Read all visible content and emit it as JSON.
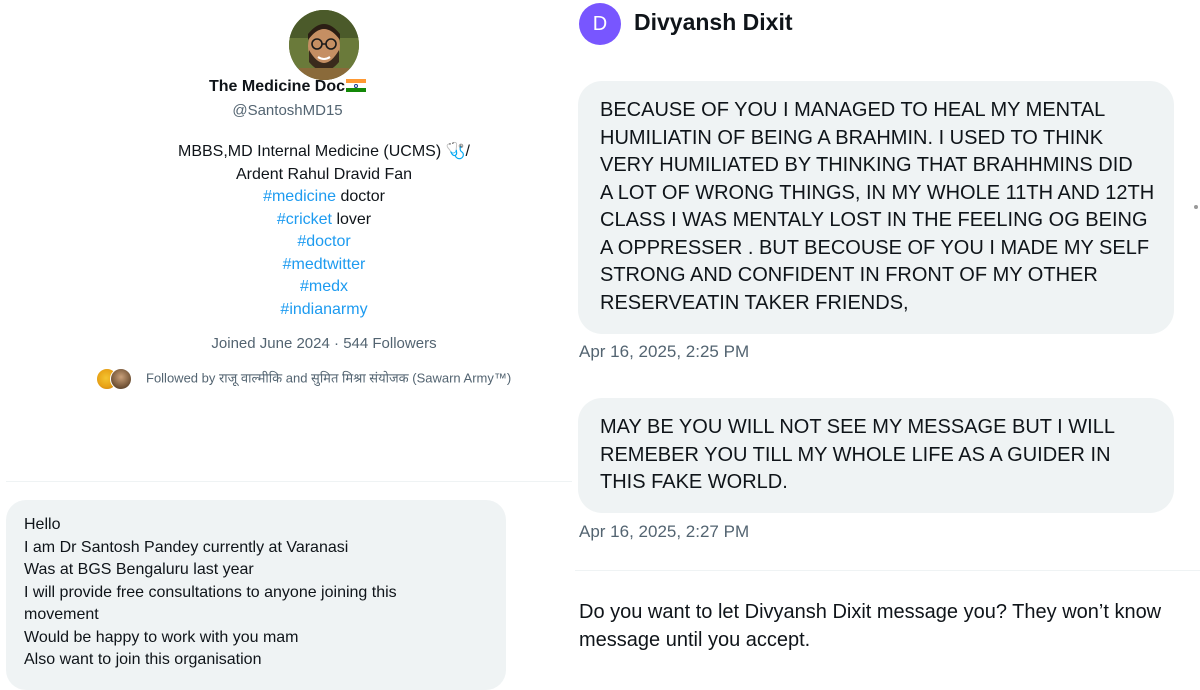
{
  "profile": {
    "name": "The Medicine Doc",
    "handle": "@SantoshMD15",
    "bio_lines": [
      {
        "text": "MBBS,MD Internal Medicine (UCMS) 🩺/",
        "tag": ""
      },
      {
        "text": "Ardent Rahul Dravid Fan",
        "tag": ""
      },
      {
        "tag": "#medicine",
        "text": " doctor"
      },
      {
        "tag": "#cricket",
        "text": " lover"
      },
      {
        "tag": "#doctor",
        "text": ""
      },
      {
        "tag": "#medtwitter",
        "text": ""
      },
      {
        "tag": "#medx",
        "text": ""
      },
      {
        "tag": "#indianarmy",
        "text": ""
      }
    ],
    "joined": "Joined June 2024",
    "followers": "544 Followers",
    "meta_separator": " · ",
    "followed_by": "Followed by राजू वाल्मीकि and सुमित मिश्रा संयोजक (Sawarn Army™)",
    "hashtag_color": "#1d9bf0"
  },
  "left_message": {
    "lines": [
      "Hello",
      "I am Dr Santosh Pandey currently at Varanasi",
      "Was at BGS Bengaluru last year",
      "I will provide free consultations to anyone joining this",
      "movement",
      "Would be happy to work with you mam",
      "Also want to join this organisation"
    ]
  },
  "dm": {
    "avatar_letter": "D",
    "avatar_color": "#7856ff",
    "name": "Divyansh Dixit",
    "messages": [
      {
        "lines": [
          "BECAUSE OF YOU I MANAGED TO HEAL MY MENTAL",
          "HUMILIATIN OF BEING A BRAHMIN. I USED TO THINK",
          "VERY HUMILIATED BY THINKING THAT BRAHHMINS DID",
          "A LOT OF WRONG THINGS, IN MY WHOLE 11TH AND 12TH",
          "CLASS I WAS MENTALY LOST IN THE FEELING OG BEING",
          "A OPPRESSER . BUT BECOUSE OF YOU I MADE MY SELF",
          "STRONG AND CONFIDENT IN FRONT OF MY OTHER",
          "RESERVEATIN TAKER FRIENDS,"
        ],
        "timestamp": "Apr 16, 2025, 2:25 PM"
      },
      {
        "lines": [
          "MAY BE YOU WILL NOT SEE MY MESSAGE BUT I WILL",
          "REMEBER YOU TILL MY WHOLE LIFE AS A GUIDER IN",
          "THIS FAKE WORLD."
        ],
        "timestamp": "Apr 16, 2025, 2:27 PM"
      }
    ],
    "request_lines": [
      "Do you want to let Divyansh Dixit message you? They won’t know",
      "message until you accept."
    ]
  }
}
